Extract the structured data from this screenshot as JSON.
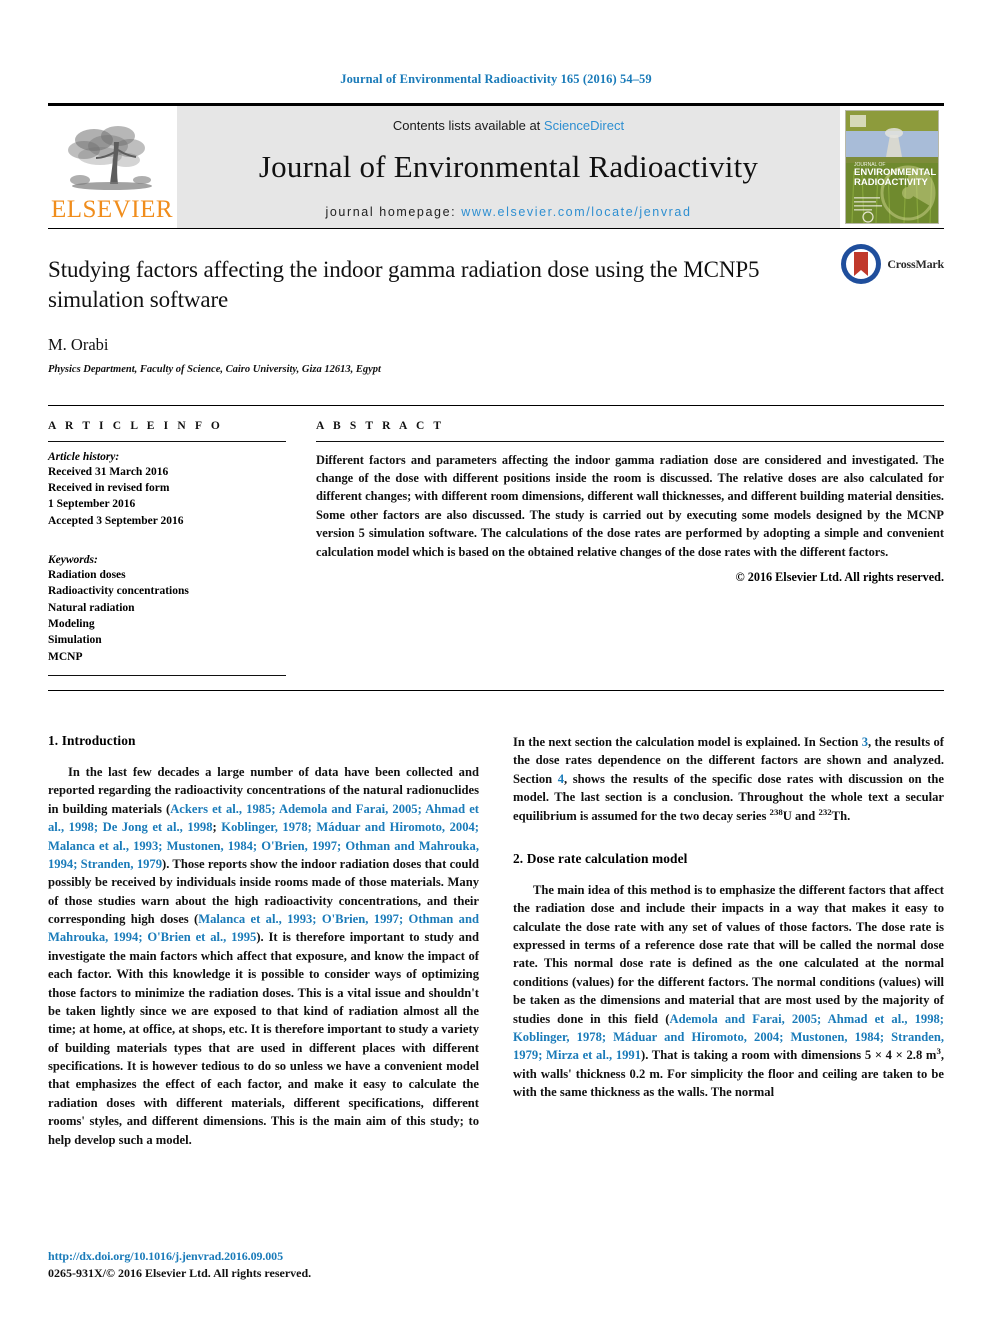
{
  "running_head": "Journal of Environmental Radioactivity 165 (2016) 54–59",
  "masthead": {
    "publisher_name": "ELSEVIER",
    "contents_prefix": "Contents lists available at ",
    "contents_link": "ScienceDirect",
    "journal_title": "Journal of Environmental Radioactivity",
    "homepage_label": "journal homepage: ",
    "homepage_url": "www.elsevier.com/locate/jenvrad",
    "cover_title_line1": "JOURNAL OF",
    "cover_title_line2": "ENVIRONMENTAL",
    "cover_title_line3": "RADIOACTIVITY",
    "cover_color": "#8d9b3c"
  },
  "title_block": {
    "title": "Studying factors affecting the indoor gamma radiation dose using the MCNP5 simulation software",
    "author": "M. Orabi",
    "affiliation": "Physics Department, Faculty of Science, Cairo University, Giza 12613, Egypt",
    "crossmark_label": "CrossMark"
  },
  "article_info": {
    "heading": "A R T I C L E   I N F O",
    "history_label": "Article history:",
    "history": [
      "Received 31 March 2016",
      "Received in revised form",
      "1 September 2016",
      "Accepted 3 September 2016"
    ],
    "keywords_label": "Keywords:",
    "keywords": [
      "Radiation doses",
      "Radioactivity concentrations",
      "Natural radiation",
      "Modeling",
      "Simulation",
      "MCNP"
    ]
  },
  "abstract": {
    "heading": "A B S T R A C T",
    "text": "Different factors and parameters affecting the indoor gamma radiation dose are considered and investigated. The change of the dose with different positions inside the room is discussed. The relative doses are also calculated for different changes; with different room dimensions, different wall thicknesses, and different building material densities. Some other factors are also discussed. The study is carried out by executing some models designed by the MCNP version 5 simulation software. The calculations of the dose rates are performed by adopting a simple and convenient calculation model which is based on the obtained relative changes of the dose rates with the different factors.",
    "copyright": "© 2016 Elsevier Ltd. All rights reserved."
  },
  "body": {
    "section1_heading": "1. Introduction",
    "section2_heading": "2. Dose rate calculation model",
    "p1_a": "In the last few decades a large number of data have been collected and reported regarding the radioactivity concentrations of the natural radionuclides in building materials (",
    "p1_refs1": "Ackers et al., 1985; Ademola and Farai, 2005; Ahmad et al., 1998; De Jong et al., 1998",
    "p1_b": "; ",
    "p1_refs2": "Koblinger, 1978; Máduar and Hiromoto, 2004; Malanca et al., 1993; Mustonen, 1984; O'Brien, 1997; Othman and Mahrouka, 1994; Stranden, 1979",
    "p1_c": "). Those reports show the indoor radiation doses that could possibly be received by individuals inside rooms made of those materials. Many of those studies warn about the high radioactivity concentrations, and their corresponding high doses (",
    "p1_refs3": "Malanca et al., 1993; O'Brien, 1997; Othman and Mahrouka, 1994; O'Brien et al., 1995",
    "p1_d": "). It is therefore important to study and investigate the main factors which affect that exposure, and know the impact of each factor. With this knowledge it is possible to consider ways of optimizing those factors to minimize the radiation doses. This is a vital issue and shouldn't be taken lightly since we are exposed to that kind of radiation almost all the time; at home, at office, at shops, etc. It is therefore important to study a variety of building materials types that are used in different places with different specifications. It is however tedious to do so unless we have a convenient model that emphasizes the effect of each factor, and make it easy to calculate the radiation doses with different materials, different specifications, different rooms' styles, and different dimensions. This is the main aim of this study; to help develop such a model.",
    "p2_a": "In the next section the calculation model is explained. In Section ",
    "p2_ref3": "3",
    "p2_b": ", the results of the dose rates dependence on the different factors are shown and analyzed. Section ",
    "p2_ref4": "4",
    "p2_c": ", shows the results of the specific dose rates with discussion on the model. The last section is a conclusion. Throughout the whole text a secular equilibrium is assumed for the two decay series ",
    "p2_sup1": "238",
    "p2_d": "U and ",
    "p2_sup2": "232",
    "p2_e": "Th.",
    "p3_a": "The main idea of this method is to emphasize the different factors that affect the radiation dose and include their impacts in a way that makes it easy to calculate the dose rate with any set of values of those factors. The dose rate is expressed in terms of a reference dose rate that will be called the normal dose rate. This normal dose rate is defined as the one calculated at the normal conditions (values) for the different factors. The normal conditions (values) will be taken as the dimensions and material that are most used by the majority of studies done in this field (",
    "p3_refs": "Ademola and Farai, 2005; Ahmad et al., 1998; Koblinger, 1978; Máduar and Hiromoto, 2004; Mustonen, 1984; Stranden, 1979; Mirza et al., 1991",
    "p3_b": "). That is taking a room with dimensions 5 × 4 × 2.8 m",
    "p3_sup": "3",
    "p3_c": ", with walls' thickness 0.2 m. For simplicity the floor and ceiling are taken to be with the same thickness as the walls. The normal"
  },
  "footer": {
    "doi": "http://dx.doi.org/10.1016/j.jenvrad.2016.09.005",
    "issn": "0265-931X/© 2016 Elsevier Ltd. All rights reserved."
  },
  "colors": {
    "link": "#1a7bb9",
    "sciencedirect": "#2e8fd1",
    "elsevier_orange": "#f08d1c"
  }
}
